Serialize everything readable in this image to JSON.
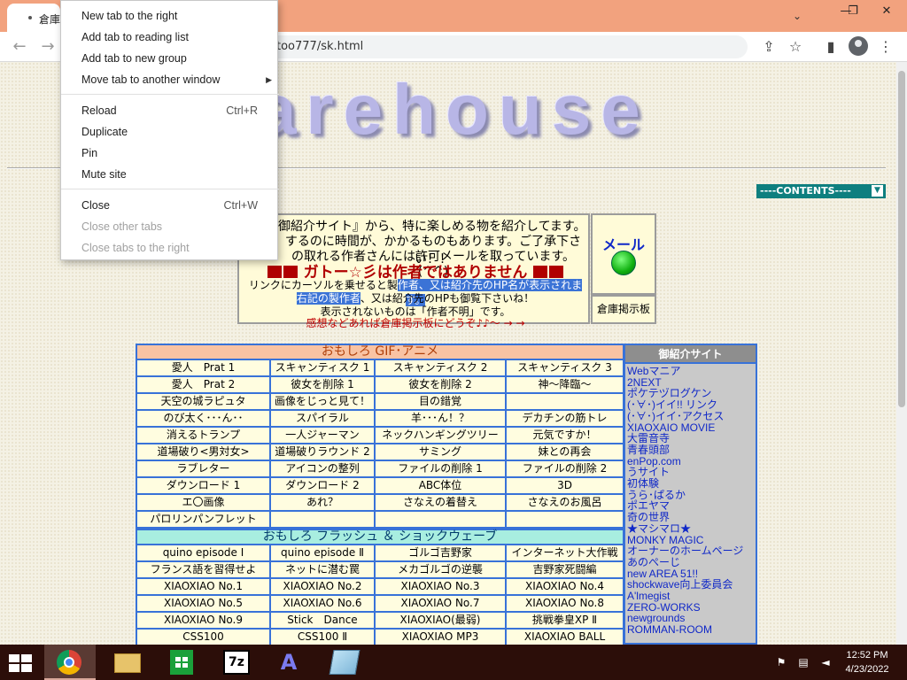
{
  "tab": {
    "title": "倉庫"
  },
  "window": {
    "minimize": "—",
    "restore": "❐",
    "close": "✕",
    "tabsearch": "⌄"
  },
  "toolbar": {
    "back": "←",
    "forward": "→",
    "url": "too777/sk.html",
    "share_icon": "⇪",
    "star_icon": "☆",
    "sidepanel_icon": "▮",
    "menu_icon": "⋮"
  },
  "page": {
    "logo": "arehouse",
    "contents_select": "----CONTENTS----",
    "intro": {
      "line1": "御紹介サイト』から、特に楽しめる物を紹介してます。",
      "line2": "するのに時間が、かかるものもあります。ご了承下さい！！",
      "line3": "の取れる作者さんには許可メールを取っています。(^^)",
      "warning": "ガトー☆彡は作者ではありません",
      "hint1_a": "リンクにカーソルを乗せると製",
      "hint1_b": "作者、又は紹介先のHP名が表示されます。",
      "hint2_a": "右記の製作者",
      "hint2_b": "、又は紹介先のHPも御覧下さいね！",
      "hint3": "表示されないものは「作者不明」です。",
      "hint4": "感想などあれば倉庫掲示板にどうぞ♪♪～ → →"
    },
    "mail_label": "メール",
    "bbs_label": "倉庫掲示板",
    "gif_section": "おもしろ GIF･アニメ",
    "gif_rows": [
      [
        "愛人　Prat 1",
        "スキャンティスク 1",
        "スキャンティスク 2",
        "スキャンティスク 3"
      ],
      [
        "愛人　Prat 2",
        "彼女を削除 1",
        "彼女を削除 2",
        "神～降臨～"
      ],
      [
        "天空の城ラピュタ",
        "画像をじっと見て！",
        "目の錯覚",
        ""
      ],
      [
        "のび太く･･･ん･･",
        "スパイラル",
        "羊･･･ん！？",
        "デカチンの筋トレ"
      ],
      [
        "消えるトランプ",
        "一人ジャーマン",
        "ネックハンギングツリー",
        "元気ですか！"
      ],
      [
        "道場破り<男対女>",
        "道場破りラウンド 2",
        "サミング",
        "妹との再会"
      ],
      [
        "ラブレター",
        "アイコンの整列",
        "ファイルの削除 1",
        "ファイルの削除 2"
      ],
      [
        "ダウンロード 1",
        "ダウンロード 2",
        "ABC体位",
        "3D"
      ],
      [
        "エ〇画像",
        "あれ？",
        "さなえの着替え",
        "さなえのお風呂"
      ],
      [
        "パロリンパンフレット",
        "",
        "",
        ""
      ]
    ],
    "flash_section": "おもしろ フラッシュ ＆ ショックウェーブ",
    "flash_rows": [
      [
        "quino episode Ⅰ",
        "quino episode Ⅱ",
        "ゴルゴ吉野家",
        "インターネット大作戦"
      ],
      [
        "フランス語を習得せよ",
        "ネットに潜む罠",
        "メカゴルゴの逆襲",
        "吉野家死闘編"
      ],
      [
        "XIAOXIAO No.1",
        "XIAOXIAO No.2",
        "XIAOXIAO No.3",
        "XIAOXIAO No.4"
      ],
      [
        "XIAOXIAO No.5",
        "XIAOXIAO No.6",
        "XIAOXIAO No.7",
        "XIAOXIAO No.8"
      ],
      [
        "XIAOXIAO No.9",
        "Stick　Dance",
        "XIAOXIAO(最弱)",
        "挑戦拳皇XP Ⅱ"
      ],
      [
        "CSS100",
        "CSS100 Ⅱ",
        "XIAOXIAO MP3",
        "XIAOXIAO BALL"
      ]
    ],
    "side_header": "御紹介サイト",
    "side_links": [
      "Webマニア",
      "2NEXT",
      "ポケテヅログケン",
      "(･∀･)イイ!! リンク",
      "(･∀･)イイ･アクセス",
      "XIAOXAIO MOVIE",
      "大雷音寺",
      "青春頭部",
      "enPop.com",
      "うサイト",
      "初体験",
      "うら･ぱるか",
      "ポエヤマ",
      "奇の世界",
      "★マシマロ★",
      "MONKY MAGIC",
      "オーナーのホームページ",
      "あのぺーじ",
      "new AREA 51!!",
      "shockwave向上委員会",
      "A'lmegist",
      "ZERO-WORKS",
      "newgrounds",
      "ROMMAN-ROOM"
    ]
  },
  "context_menu": {
    "new_tab_right": "New tab to the right",
    "add_reading": "Add tab to reading list",
    "add_group": "Add tab to new group",
    "move_window": "Move tab to another window",
    "reload": "Reload",
    "reload_sc": "Ctrl+R",
    "duplicate": "Duplicate",
    "pin": "Pin",
    "mute": "Mute site",
    "close": "Close",
    "close_sc": "Ctrl+W",
    "close_others": "Close other tabs",
    "close_right": "Close tabs to the right"
  },
  "taskbar": {
    "time": "12:52 PM",
    "date": "4/23/2022"
  },
  "colors": {
    "tabstrip": "#f2a27e",
    "taskbar": "#2c0e09",
    "table_border": "#3872d8",
    "link": "#1028c8"
  }
}
